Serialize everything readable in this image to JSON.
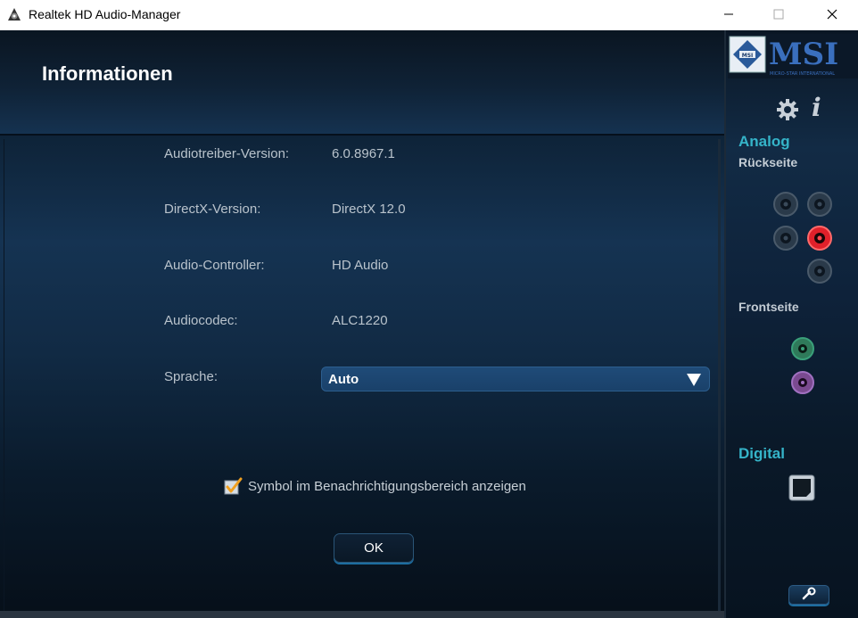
{
  "window": {
    "title": "Realtek HD Audio-Manager",
    "controls": [
      "minimize",
      "maximize",
      "close"
    ]
  },
  "header": {
    "title": "Informationen"
  },
  "info": {
    "rows": [
      {
        "label": "Audiotreiber-Version:",
        "value": "6.0.8967.1"
      },
      {
        "label": "DirectX-Version:",
        "value": "DirectX 12.0"
      },
      {
        "label": "Audio-Controller:",
        "value": "HD Audio"
      },
      {
        "label": "Audiocodec:",
        "value": "ALC1220"
      }
    ],
    "language_label": "Sprache:",
    "language_value": "Auto"
  },
  "tray_checkbox": {
    "label": "Symbol im Benachrichtigungsbereich anzeigen",
    "checked": true
  },
  "ok_button": {
    "label": "OK"
  },
  "sidebar": {
    "logo_text": "MSI",
    "logo_subtext": "MICRO-STAR INTERNATIONAL",
    "analog_heading": "Analog",
    "rear_label": "Rückseite",
    "front_label": "Frontseite",
    "digital_heading": "Digital",
    "rear_jacks": [
      {
        "color": "#3a4a5a",
        "active": false
      },
      {
        "color": "#3a4a5a",
        "active": false
      },
      {
        "color": "#3a4a5a",
        "active": false
      },
      {
        "color": "#e0202a",
        "active": true
      },
      {
        "color": "#3a4a5a",
        "active": false
      }
    ],
    "front_jacks": [
      {
        "color": "#2f9a6a",
        "active": false
      },
      {
        "color": "#9a5ab0",
        "active": false
      }
    ],
    "icons": [
      "gear-icon",
      "info-icon",
      "wrench-icon",
      "digital-port-icon"
    ]
  },
  "colors": {
    "accent": "#35b4c9",
    "select_bg": "#1f4b78",
    "active_jack": "#e0202a"
  }
}
